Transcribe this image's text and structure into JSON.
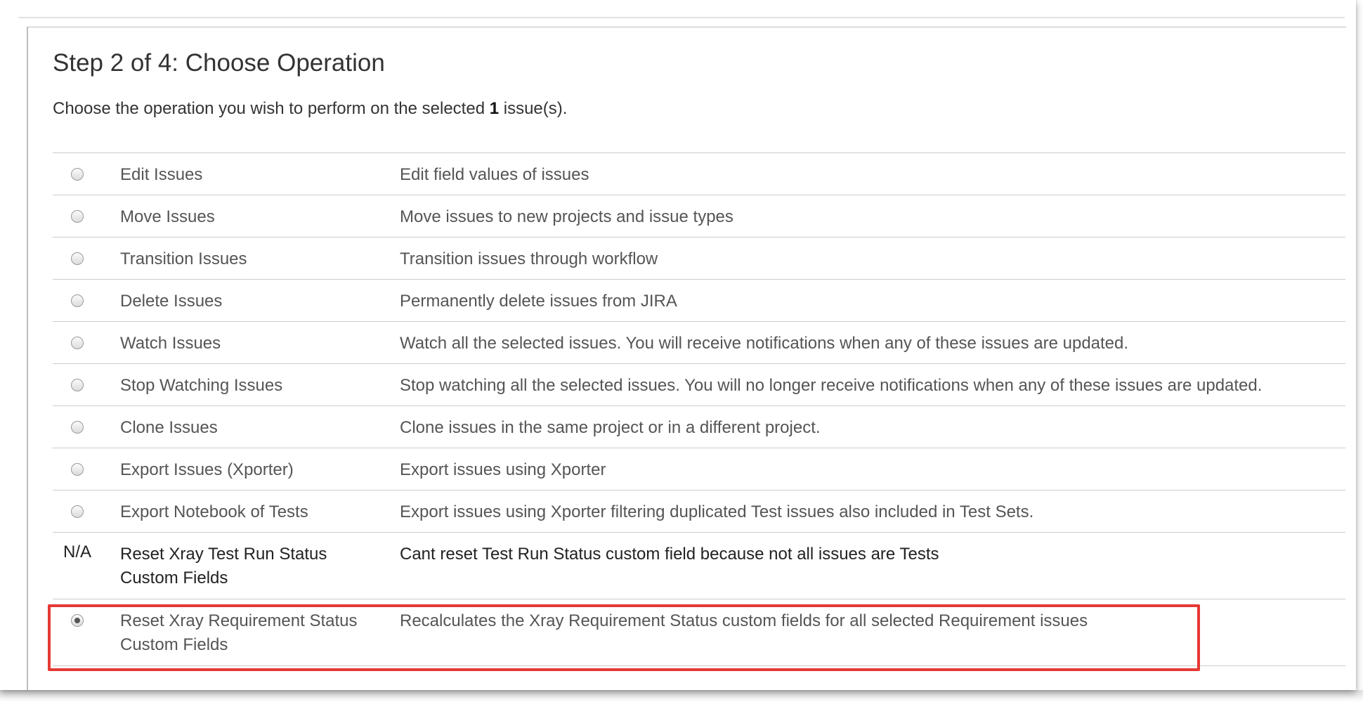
{
  "page": {
    "title": "Step 2 of 4: Choose Operation",
    "subtitle_prefix": "Choose the operation you wish to perform on the selected ",
    "subtitle_count": "1",
    "subtitle_suffix": " issue(s)."
  },
  "operations": [
    {
      "name": "Edit Issues",
      "description": "Edit field values of issues",
      "selector": "radio",
      "selected": false
    },
    {
      "name": "Move Issues",
      "description": "Move issues to new projects and issue types",
      "selector": "radio",
      "selected": false
    },
    {
      "name": "Transition Issues",
      "description": "Transition issues through workflow",
      "selector": "radio",
      "selected": false
    },
    {
      "name": "Delete Issues",
      "description": "Permanently delete issues from JIRA",
      "selector": "radio",
      "selected": false
    },
    {
      "name": "Watch Issues",
      "description": "Watch all the selected issues. You will receive notifications when any of these issues are updated.",
      "selector": "radio",
      "selected": false
    },
    {
      "name": "Stop Watching Issues",
      "description": "Stop watching all the selected issues. You will no longer receive notifications when any of these issues are updated.",
      "selector": "radio",
      "selected": false
    },
    {
      "name": "Clone Issues",
      "description": "Clone issues in the same project or in a different project.",
      "selector": "radio",
      "selected": false
    },
    {
      "name": "Export Issues (Xporter)",
      "description": "Export issues using Xporter",
      "selector": "radio",
      "selected": false
    },
    {
      "name": "Export Notebook of Tests",
      "description": "Export issues using Xporter filtering duplicated Test issues also included in Test Sets.",
      "selector": "radio",
      "selected": false
    },
    {
      "name": "Reset Xray Test Run Status Custom Fields",
      "description": "Cant reset Test Run Status custom field because not all issues are Tests",
      "selector": "N/A",
      "selected": false
    },
    {
      "name": "Reset Xray Requirement Status Custom Fields",
      "description": "Recalculates the Xray Requirement Status custom fields for all selected Requirement issues",
      "selector": "radio",
      "selected": true
    }
  ],
  "colors": {
    "highlight": "#e53935",
    "text": "#555555",
    "divider": "#cccccc"
  }
}
